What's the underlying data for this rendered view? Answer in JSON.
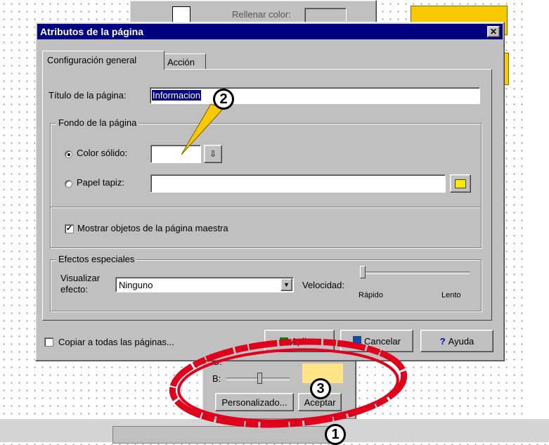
{
  "background_panel": {
    "fill_color_label": "Rellenar color:",
    "g_label": "G:",
    "b_label": "B:",
    "custom_button": "Personalizado...",
    "accept_button": "Aceptar"
  },
  "dialog": {
    "title": "Atributos de la página",
    "close_glyph": "✕",
    "tabs": [
      {
        "label": "Configuración general",
        "active": true
      },
      {
        "label": "Acción",
        "active": false
      }
    ],
    "page_title_label": "Título de la página:",
    "page_title_value": "Informacion",
    "background_group": {
      "legend": "Fondo de la página",
      "solid_color_label": "Color sólido:",
      "wallpaper_label": "Papel tapiz:",
      "wallpaper_value": "",
      "selected": "solid"
    },
    "show_master_label": "Mostrar objetos de la página maestra",
    "show_master_checked": true,
    "effects_group": {
      "legend": "Efectos especiales",
      "visualize_label_1": "Visualizar",
      "visualize_label_2": "efecto:",
      "effect_value": "Ninguno",
      "speed_label": "Velocidad:",
      "speed_fast": "Rápido",
      "speed_slow": "Lento",
      "speed_level": 0
    },
    "copy_all_label": "Copiar a todas las páginas...",
    "copy_all_checked": false,
    "apply_button": "Aplicar",
    "cancel_button": "Cancelar",
    "help_button": "Ayuda"
  },
  "callouts": [
    "1",
    "2",
    "3"
  ],
  "colors": {
    "title_bar": "#000080",
    "accent_yellow": "#f8c800",
    "swatch_yellow": "#ffe488",
    "annotation_red": "#e0001c"
  }
}
